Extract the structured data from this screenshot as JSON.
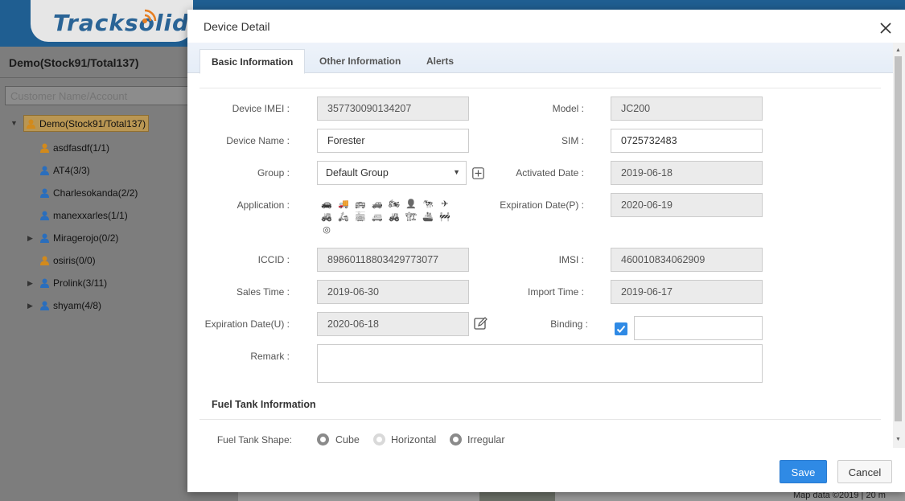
{
  "app": {
    "logo": "Tracksolid"
  },
  "sidebar": {
    "title": "Demo(Stock91/Total137)",
    "search_placeholder": "Customer Name/Account",
    "root": "Demo(Stock91/Total137)",
    "items": [
      {
        "label": "asdfasdf(1/1)",
        "expandable": false,
        "color": "#d28a1c"
      },
      {
        "label": "AT4(3/3)",
        "expandable": false,
        "color": "#2a6ebd"
      },
      {
        "label": "Charlesokanda(2/2)",
        "expandable": false,
        "color": "#2a6ebd"
      },
      {
        "label": "manexxarles(1/1)",
        "expandable": false,
        "color": "#2a6ebd"
      },
      {
        "label": "Miragerojo(0/2)",
        "expandable": true,
        "color": "#2a6ebd"
      },
      {
        "label": "osiris(0/0)",
        "expandable": false,
        "color": "#d28a1c"
      },
      {
        "label": "Prolink(3/11)",
        "expandable": true,
        "color": "#2a6ebd"
      },
      {
        "label": "shyam(4/8)",
        "expandable": true,
        "color": "#2a6ebd"
      }
    ]
  },
  "map": {
    "attribution": "Map data ©2019 | 20 m"
  },
  "modal": {
    "title": "Device Detail",
    "tabs": [
      "Basic Information",
      "Other Information",
      "Alerts"
    ],
    "active_tab": "Basic Information",
    "fields": {
      "imei": {
        "label": "Device IMEI :",
        "value": "357730090134207"
      },
      "model": {
        "label": "Model :",
        "value": "JC200"
      },
      "device_name": {
        "label": "Device Name :",
        "value": "Forester"
      },
      "sim": {
        "label": "SIM :",
        "value": "0725732483"
      },
      "group": {
        "label": "Group :",
        "value": "Default Group"
      },
      "activated_date": {
        "label": "Activated Date :",
        "value": "2019-06-18"
      },
      "application": {
        "label": "Application :"
      },
      "expiration_p": {
        "label": "Expiration Date(P) :",
        "value": "2020-06-19"
      },
      "iccid": {
        "label": "ICCID :",
        "value": "89860118803429773077"
      },
      "imsi": {
        "label": "IMSI :",
        "value": "460010834062909"
      },
      "sales_time": {
        "label": "Sales Time :",
        "value": "2019-06-30"
      },
      "import_time": {
        "label": "Import Time :",
        "value": "2019-06-17"
      },
      "expiration_u": {
        "label": "Expiration Date(U) :",
        "value": "2020-06-18"
      },
      "binding": {
        "label": "Binding :",
        "checked": true,
        "value": ""
      },
      "remark": {
        "label": "Remark :",
        "value": ""
      }
    },
    "application_icons": [
      "car-icon",
      "truck-icon",
      "bus-icon",
      "suv-icon",
      "motorcycle-icon",
      "person-icon",
      "cow-icon",
      "drone-icon",
      "excavator-icon",
      "scooter-icon",
      "tram-icon",
      "van-icon",
      "tractor-icon",
      "crane-icon",
      "ship-icon",
      "loader-icon",
      "other-icon"
    ],
    "selected_application": "truck-icon",
    "fuel": {
      "section_title": "Fuel Tank Information",
      "shape_label": "Fuel Tank Shape:",
      "options": [
        "Cube",
        "Horizontal",
        "Irregular"
      ]
    },
    "buttons": {
      "save": "Save",
      "cancel": "Cancel"
    },
    "colors": {
      "primary": "#2f8ae5",
      "header": "#1f5e91"
    }
  }
}
